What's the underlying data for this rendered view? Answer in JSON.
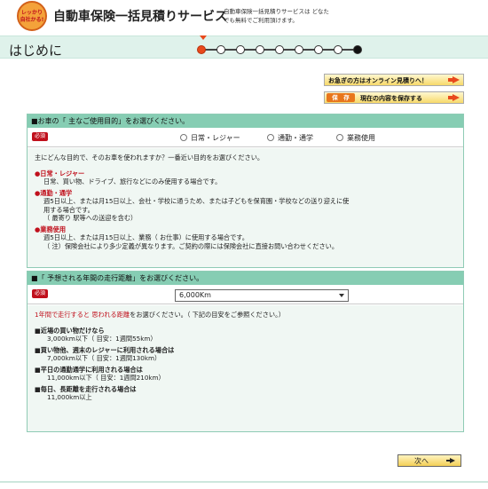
{
  "header": {
    "badge": "レッかり\n自社かる!",
    "title": "自動車保険一括見積りサービス",
    "subtitle": "自動車保険一括見積りサービスは どなたでも無料でご利用頂けます。"
  },
  "page": {
    "title": "はじめに",
    "online_prompt": "お急ぎの方はオンライン見積りへ！",
    "save_tag": "保　存",
    "save_text": "現在の内容を保存する"
  },
  "section1": {
    "heading": "■お車の「 主なご使用目的」をお選びください。",
    "required": "必須",
    "options": [
      "日常・レジャー",
      "通勤・通学",
      "業務使用"
    ],
    "lead": "主にどんな目的で、そのお車を使われますか？一番近い目的をお選びください。",
    "opt1_title": "日常・レジャー",
    "opt1_desc": "日常、買い物、ドライブ、旅行などにのみ使用する場合です。",
    "opt2_title": "通勤・通学",
    "opt2_desc1": "週5日以上、または月15日以上、会社・学校に通うため、または子どもを保育園・学校などの送り迎えに使",
    "opt2_desc2": "用する場合です。",
    "opt2_desc3": "（ 最寄り 駅等への送迎を含む）",
    "opt3_title": "業務使用",
    "opt3_desc1": "週5日以上、または月15日以上、業務（ お仕事）に使用する場合です。",
    "opt3_desc2": "（ 注）保険会社により多少定義が異なります。ご契約の際には保険会社に直接お問い合わせください。"
  },
  "section2": {
    "heading": "■「 予想される年間の走行距離」をお選びください。",
    "required": "必須",
    "selected": "6,000Km",
    "lead_red": "1年間で走行すると 思われる距離",
    "lead_rest": "をお選びください。（ 下記の目安をご参照ください。）",
    "items": [
      {
        "title": "■近場の買い物だけなら",
        "sub": "3,000km以下（ 目安：1週間55km）"
      },
      {
        "title": "■買い物他、週末のレジャーに利用される場合は",
        "sub": "7,000km以下（ 目安：1週間130km）"
      },
      {
        "title": "■平日の通勤通学に利用される場合は",
        "sub": "11,000km以下（ 目安：1週間210km）"
      },
      {
        "title": "■毎日、長距離を走行される場合は",
        "sub": "11,000km以上"
      }
    ]
  },
  "footer": {
    "next_label": "次へ"
  }
}
